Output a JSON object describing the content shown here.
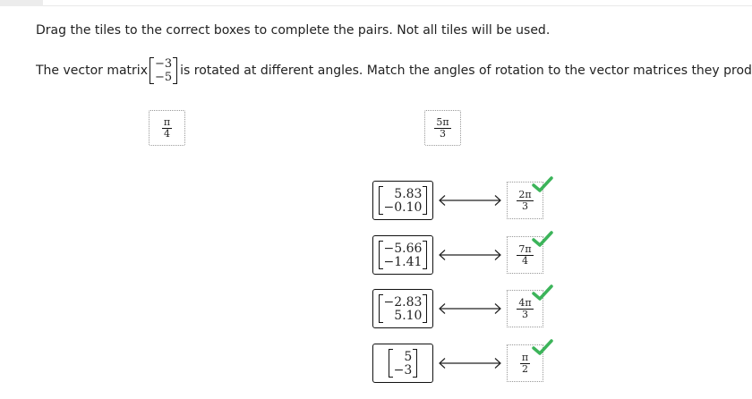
{
  "instruction": "Drag the tiles to the correct boxes to complete the pairs. Not all tiles will be used.",
  "question": {
    "before": "The vector matrix",
    "after": "is rotated at different angles. Match the angles of rotation to the vector matrices they produce.",
    "matrix": [
      "−3",
      "−5"
    ]
  },
  "tiles": [
    {
      "num": "π",
      "den": "4"
    },
    {
      "num": "5π",
      "den": "3"
    }
  ],
  "pairs": [
    {
      "matrix": [
        "5.83",
        "−0.10"
      ],
      "answer": {
        "num": "2π",
        "den": "3"
      },
      "status": "correct"
    },
    {
      "matrix": [
        "−5.66",
        "−1.41"
      ],
      "answer": {
        "num": "7π",
        "den": "4"
      },
      "status": "correct"
    },
    {
      "matrix": [
        "−2.83",
        "5.10"
      ],
      "answer": {
        "num": "4π",
        "den": "3"
      },
      "status": "correct"
    },
    {
      "matrix": [
        "5",
        "−3"
      ],
      "answer": {
        "num": "π",
        "den": "2"
      },
      "status": "correct"
    }
  ],
  "colors": {
    "check": "#3cb45a"
  },
  "icons": {
    "arrow": "double-headed-arrow-icon",
    "check": "checkmark-icon"
  }
}
